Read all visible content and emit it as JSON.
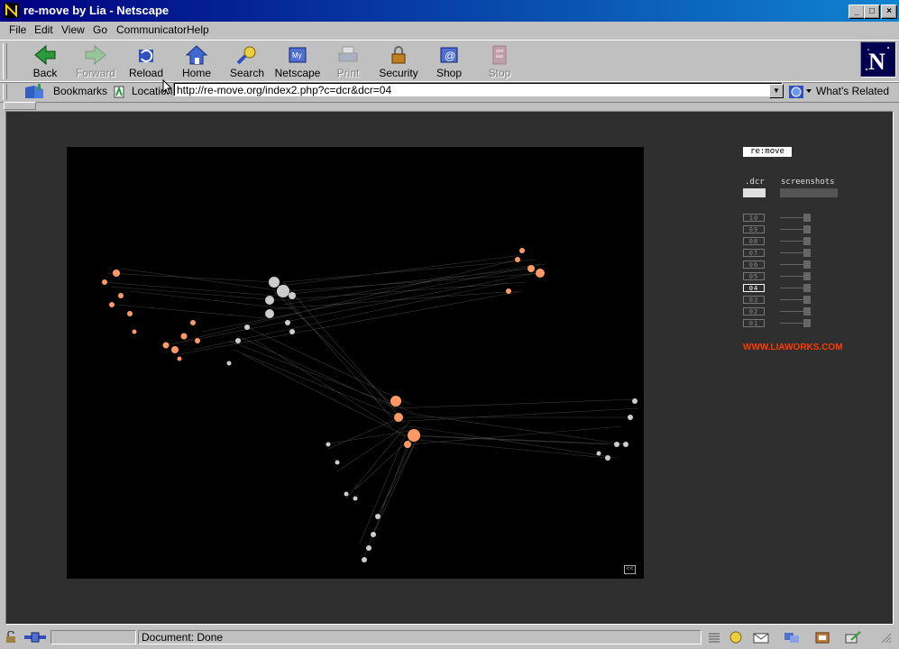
{
  "window": {
    "title": "re-move by Lia - Netscape"
  },
  "menu": [
    "File",
    "Edit",
    "View",
    "Go",
    "Communicator",
    "Help"
  ],
  "toolbar": [
    {
      "label": "Back",
      "icon": "back-arrow-icon",
      "enabled": true
    },
    {
      "label": "Forward",
      "icon": "forward-arrow-icon",
      "enabled": false
    },
    {
      "label": "Reload",
      "icon": "reload-icon",
      "enabled": true
    },
    {
      "label": "Home",
      "icon": "home-icon",
      "enabled": true
    },
    {
      "label": "Search",
      "icon": "search-icon",
      "enabled": true
    },
    {
      "label": "Netscape",
      "icon": "my-netscape-icon",
      "enabled": true
    },
    {
      "label": "Print",
      "icon": "print-icon",
      "enabled": false
    },
    {
      "label": "Security",
      "icon": "lock-icon",
      "enabled": true
    },
    {
      "label": "Shop",
      "icon": "shop-icon",
      "enabled": true
    },
    {
      "label": "Stop",
      "icon": "stop-icon",
      "enabled": false
    }
  ],
  "location": {
    "bookmarks_label": "Bookmarks",
    "location_label": "Location:",
    "url": "http://re-move.org/index2.php?c=dcr&dcr=04",
    "whats_related": "What's Related"
  },
  "page": {
    "logo": "re:move",
    "col_dcr": ".dcr",
    "col_screenshots": "screenshots",
    "items": [
      "10",
      "09",
      "08",
      "07",
      "06",
      "05",
      "04",
      "03",
      "02",
      "01"
    ],
    "selected": "04",
    "link": "WWW.LIAWORKS.COM",
    "corner_button": "<<"
  },
  "status": {
    "text": "Document: Done"
  },
  "colors": {
    "title_start": "#000080",
    "title_end": "#1084d0",
    "link": "#ff3a00",
    "points_orange": "#ff9060"
  }
}
